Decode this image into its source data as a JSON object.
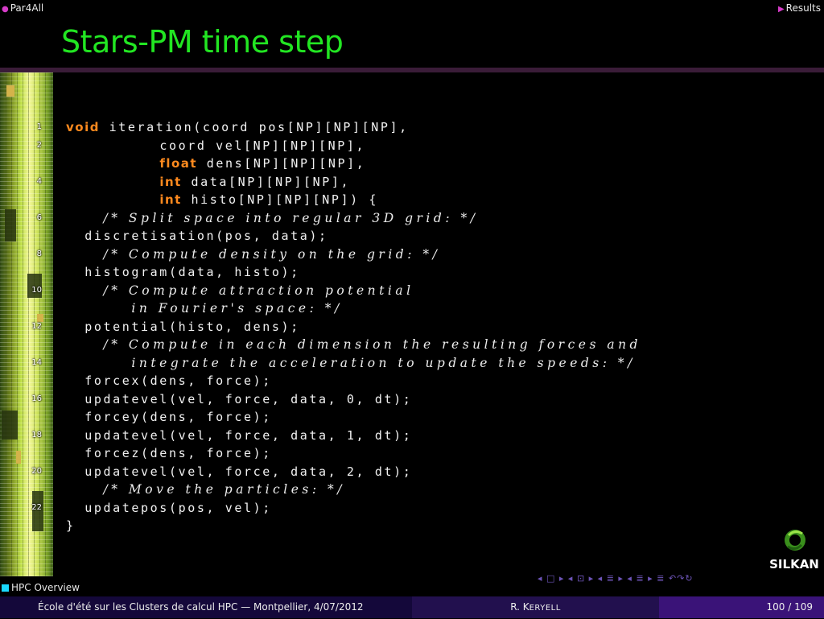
{
  "header": {
    "left_label": "Par4All",
    "right_label": "Results"
  },
  "slide": {
    "title": "Stars-PM time step",
    "line_numbers": [
      "1",
      "2",
      "4",
      "6",
      "8",
      "10",
      "12",
      "14",
      "16",
      "18",
      "20",
      "22"
    ],
    "code_lines": [
      {
        "kw": "void",
        "text": " iteration(coord pos[NP][NP][NP],",
        "indent": ""
      },
      {
        "kw": "",
        "text": "coord vel[NP][NP][NP],",
        "indent": "          "
      },
      {
        "kw": "float",
        "text": " dens[NP][NP][NP],",
        "indent": "          "
      },
      {
        "kw": "int",
        "text": " data[NP][NP][NP],",
        "indent": "          "
      },
      {
        "kw": "int",
        "text": " histo[NP][NP][NP]) {",
        "indent": "          "
      },
      {
        "comment": "/* Split space into regular 3D grid: */",
        "indent": "    "
      },
      {
        "kw": "",
        "text": "discretisation(pos, data);",
        "indent": "  "
      },
      {
        "comment": "/* Compute density on the grid: */",
        "indent": "    "
      },
      {
        "kw": "",
        "text": "histogram(data, histo);",
        "indent": "  "
      },
      {
        "comment": "/* Compute attraction potential",
        "indent": "    "
      },
      {
        "comment": "in Fourier's space: */",
        "indent": "       "
      },
      {
        "kw": "",
        "text": "potential(histo, dens);",
        "indent": "  "
      },
      {
        "comment": "/* Compute in each dimension the resulting forces and",
        "indent": "    "
      },
      {
        "comment": "integrate the acceleration to update the speeds: */",
        "indent": "       "
      },
      {
        "kw": "",
        "text": "forcex(dens, force);",
        "indent": "  "
      },
      {
        "kw": "",
        "text": "updatevel(vel, force, data, 0, dt);",
        "indent": "  "
      },
      {
        "kw": "",
        "text": "forcey(dens, force);",
        "indent": "  "
      },
      {
        "kw": "",
        "text": "updatevel(vel, force, data, 1, dt);",
        "indent": "  "
      },
      {
        "kw": "",
        "text": "forcez(dens, force);",
        "indent": "  "
      },
      {
        "kw": "",
        "text": "updatevel(vel, force, data, 2, dt);",
        "indent": "  "
      },
      {
        "comment": "/* Move the particles: */",
        "indent": "    "
      },
      {
        "kw": "",
        "text": "updatepos(pos, vel);",
        "indent": "  "
      },
      {
        "kw": "",
        "text": "}",
        "indent": ""
      }
    ]
  },
  "logo": {
    "text": "SILKAN"
  },
  "nav_symbols": "◂ □ ▸ ◂ ⊡ ▸ ◂ ≣ ▸ ◂ ≣ ▸   ≣   ↶↷↻",
  "section": {
    "label": "HPC Overview"
  },
  "footer": {
    "left": "École d'été sur les Clusters de calcul HPC — Montpellier, 4/07/2012",
    "author_initial": "R. K",
    "author_rest": "ERYELL",
    "page": "100 / 109"
  },
  "colors": {
    "title": "#22e622",
    "keyword": "#ff8a1e",
    "accent_bullet": "#d63cc8",
    "section_square": "#1ad9ff"
  }
}
